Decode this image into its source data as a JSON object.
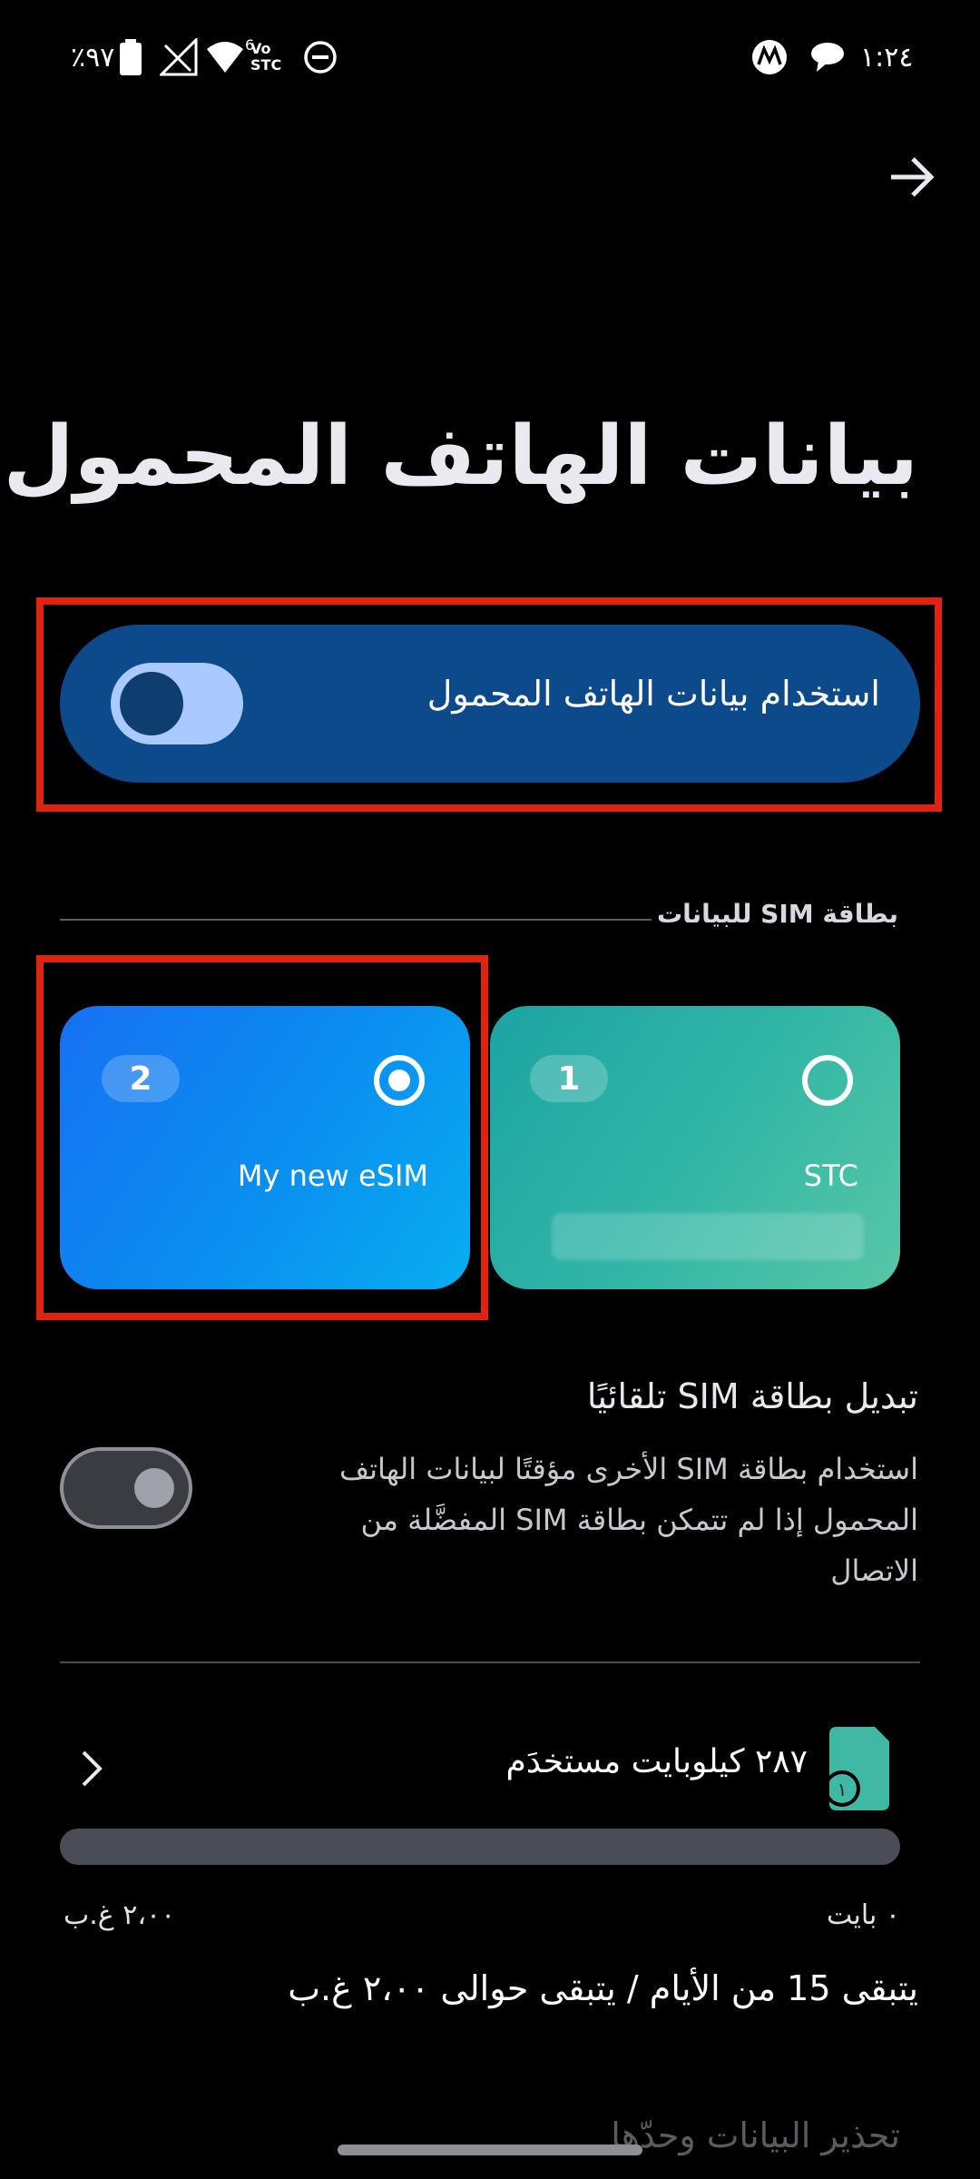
{
  "status_bar": {
    "battery_percent": "٪٩٧",
    "carrier": "Vo STC",
    "network_label": "6",
    "time": "١:٢٤"
  },
  "header": {
    "back_icon": "arrow-right-icon",
    "title": "بيانات الهاتف المحمول"
  },
  "mobile_data": {
    "label": "استخدام بيانات الهاتف المحمول",
    "enabled": true
  },
  "sim_section": {
    "header": "بطاقة SIM للبيانات",
    "cards": [
      {
        "slot": "2",
        "name": "My new eSIM",
        "selected": true
      },
      {
        "slot": "1",
        "name": "STC",
        "selected": false
      }
    ]
  },
  "auto_switch": {
    "title": "تبديل بطاقة SIM تلقائيًا",
    "description": "استخدام بطاقة SIM الأخرى مؤقتًا لبيانات الهاتف المحمول إذا لم تتمكن بطاقة SIM المفضَّلة من الاتصال",
    "enabled": false
  },
  "usage": {
    "used_text": "٢٨٧ كيلوبايت مستخدَم",
    "sim_slot": "١",
    "progress_fraction": 0.0,
    "range_min": "٠ بايت",
    "range_max": "٢،٠٠ غ.ب",
    "remaining": "يتبقى 15 من الأيام / يتبقى حوالى ٢،٠٠ غ.ب",
    "warning_link": "تحذير البيانات وحدّها"
  },
  "colors": {
    "background": "#000000",
    "master_card": "#0d4a8c",
    "toggle_on": "#a9c9ff",
    "esim_card": "#1671f2",
    "stc_card": "#30b5a6",
    "highlight": "#e02414"
  }
}
